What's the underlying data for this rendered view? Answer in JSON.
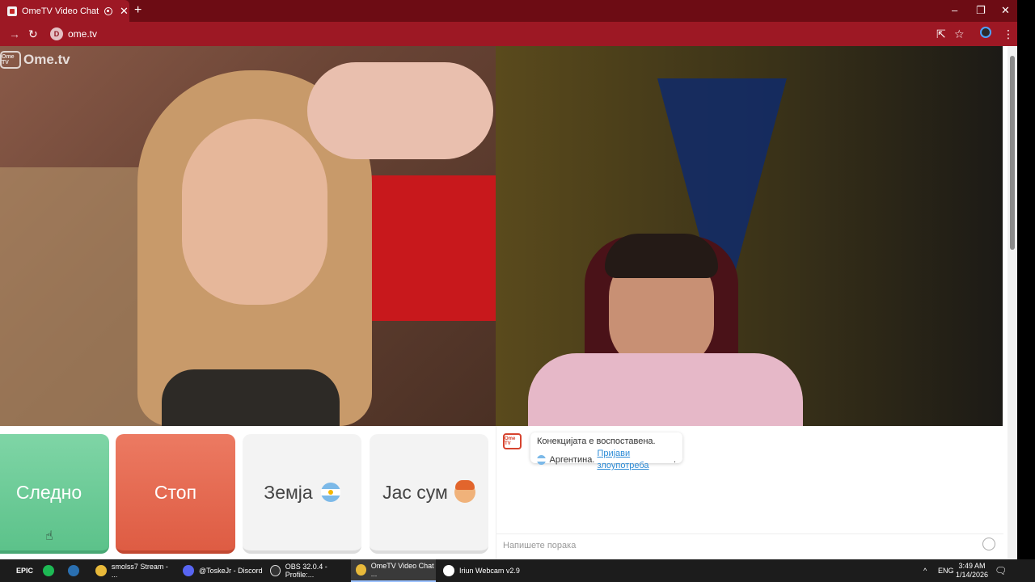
{
  "browser": {
    "tab_title": "OmeTV Video Chat — Ome",
    "new_tab": "+",
    "url": "ome.tv",
    "site_badge": "D",
    "window_controls": [
      "–",
      "❐",
      "✕"
    ]
  },
  "page": {
    "logo_text": "Ome.tv",
    "logo_tv": "Ome TV",
    "buttons": {
      "next": "Следно",
      "stop": "Стоп",
      "country": "Земја",
      "gender": "Јас сум"
    },
    "chat": {
      "system_icon": "Ome TV",
      "message_line1": "Конекцијата е воспоставена.",
      "country": "Аргентина.",
      "report_link": "Пријави злоупотреба",
      "input_placeholder": "Напишете порака"
    }
  },
  "taskbar": {
    "start_label": "EPIC",
    "apps": [
      {
        "label": "smolss7 Stream - ...",
        "icon": "chrome-icon"
      },
      {
        "label": "@ToskeJr - Discord",
        "icon": "discord-icon"
      },
      {
        "label": "OBS 32.0.4 - Profile:...",
        "icon": "obs-icon"
      },
      {
        "label": "OmeTV Video Chat ...",
        "icon": "chrome-icon"
      },
      {
        "label": "Iriun Webcam v2.9",
        "icon": "webcam-icon"
      }
    ],
    "language": "ENG",
    "time": "3:49 AM",
    "date": "1/14/2026"
  },
  "colors": {
    "browser_frame": "#6d0c14",
    "toolbar": "#9d1824",
    "next_button": "#6ccb96",
    "stop_button": "#e5684f",
    "neutral_button": "#f3f3f3"
  }
}
